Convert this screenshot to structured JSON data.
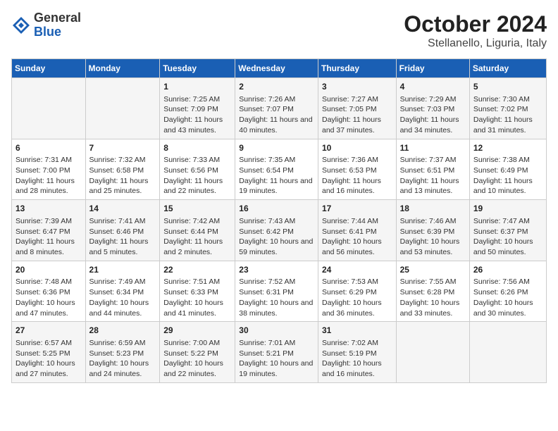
{
  "header": {
    "logo_line1": "General",
    "logo_line2": "Blue",
    "title": "October 2024",
    "subtitle": "Stellanello, Liguria, Italy"
  },
  "days_of_week": [
    "Sunday",
    "Monday",
    "Tuesday",
    "Wednesday",
    "Thursday",
    "Friday",
    "Saturday"
  ],
  "weeks": [
    [
      {
        "day": "",
        "details": ""
      },
      {
        "day": "",
        "details": ""
      },
      {
        "day": "1",
        "details": "Sunrise: 7:25 AM\nSunset: 7:09 PM\nDaylight: 11 hours and 43 minutes."
      },
      {
        "day": "2",
        "details": "Sunrise: 7:26 AM\nSunset: 7:07 PM\nDaylight: 11 hours and 40 minutes."
      },
      {
        "day": "3",
        "details": "Sunrise: 7:27 AM\nSunset: 7:05 PM\nDaylight: 11 hours and 37 minutes."
      },
      {
        "day": "4",
        "details": "Sunrise: 7:29 AM\nSunset: 7:03 PM\nDaylight: 11 hours and 34 minutes."
      },
      {
        "day": "5",
        "details": "Sunrise: 7:30 AM\nSunset: 7:02 PM\nDaylight: 11 hours and 31 minutes."
      }
    ],
    [
      {
        "day": "6",
        "details": "Sunrise: 7:31 AM\nSunset: 7:00 PM\nDaylight: 11 hours and 28 minutes."
      },
      {
        "day": "7",
        "details": "Sunrise: 7:32 AM\nSunset: 6:58 PM\nDaylight: 11 hours and 25 minutes."
      },
      {
        "day": "8",
        "details": "Sunrise: 7:33 AM\nSunset: 6:56 PM\nDaylight: 11 hours and 22 minutes."
      },
      {
        "day": "9",
        "details": "Sunrise: 7:35 AM\nSunset: 6:54 PM\nDaylight: 11 hours and 19 minutes."
      },
      {
        "day": "10",
        "details": "Sunrise: 7:36 AM\nSunset: 6:53 PM\nDaylight: 11 hours and 16 minutes."
      },
      {
        "day": "11",
        "details": "Sunrise: 7:37 AM\nSunset: 6:51 PM\nDaylight: 11 hours and 13 minutes."
      },
      {
        "day": "12",
        "details": "Sunrise: 7:38 AM\nSunset: 6:49 PM\nDaylight: 11 hours and 10 minutes."
      }
    ],
    [
      {
        "day": "13",
        "details": "Sunrise: 7:39 AM\nSunset: 6:47 PM\nDaylight: 11 hours and 8 minutes."
      },
      {
        "day": "14",
        "details": "Sunrise: 7:41 AM\nSunset: 6:46 PM\nDaylight: 11 hours and 5 minutes."
      },
      {
        "day": "15",
        "details": "Sunrise: 7:42 AM\nSunset: 6:44 PM\nDaylight: 11 hours and 2 minutes."
      },
      {
        "day": "16",
        "details": "Sunrise: 7:43 AM\nSunset: 6:42 PM\nDaylight: 10 hours and 59 minutes."
      },
      {
        "day": "17",
        "details": "Sunrise: 7:44 AM\nSunset: 6:41 PM\nDaylight: 10 hours and 56 minutes."
      },
      {
        "day": "18",
        "details": "Sunrise: 7:46 AM\nSunset: 6:39 PM\nDaylight: 10 hours and 53 minutes."
      },
      {
        "day": "19",
        "details": "Sunrise: 7:47 AM\nSunset: 6:37 PM\nDaylight: 10 hours and 50 minutes."
      }
    ],
    [
      {
        "day": "20",
        "details": "Sunrise: 7:48 AM\nSunset: 6:36 PM\nDaylight: 10 hours and 47 minutes."
      },
      {
        "day": "21",
        "details": "Sunrise: 7:49 AM\nSunset: 6:34 PM\nDaylight: 10 hours and 44 minutes."
      },
      {
        "day": "22",
        "details": "Sunrise: 7:51 AM\nSunset: 6:33 PM\nDaylight: 10 hours and 41 minutes."
      },
      {
        "day": "23",
        "details": "Sunrise: 7:52 AM\nSunset: 6:31 PM\nDaylight: 10 hours and 38 minutes."
      },
      {
        "day": "24",
        "details": "Sunrise: 7:53 AM\nSunset: 6:29 PM\nDaylight: 10 hours and 36 minutes."
      },
      {
        "day": "25",
        "details": "Sunrise: 7:55 AM\nSunset: 6:28 PM\nDaylight: 10 hours and 33 minutes."
      },
      {
        "day": "26",
        "details": "Sunrise: 7:56 AM\nSunset: 6:26 PM\nDaylight: 10 hours and 30 minutes."
      }
    ],
    [
      {
        "day": "27",
        "details": "Sunrise: 6:57 AM\nSunset: 5:25 PM\nDaylight: 10 hours and 27 minutes."
      },
      {
        "day": "28",
        "details": "Sunrise: 6:59 AM\nSunset: 5:23 PM\nDaylight: 10 hours and 24 minutes."
      },
      {
        "day": "29",
        "details": "Sunrise: 7:00 AM\nSunset: 5:22 PM\nDaylight: 10 hours and 22 minutes."
      },
      {
        "day": "30",
        "details": "Sunrise: 7:01 AM\nSunset: 5:21 PM\nDaylight: 10 hours and 19 minutes."
      },
      {
        "day": "31",
        "details": "Sunrise: 7:02 AM\nSunset: 5:19 PM\nDaylight: 10 hours and 16 minutes."
      },
      {
        "day": "",
        "details": ""
      },
      {
        "day": "",
        "details": ""
      }
    ]
  ]
}
